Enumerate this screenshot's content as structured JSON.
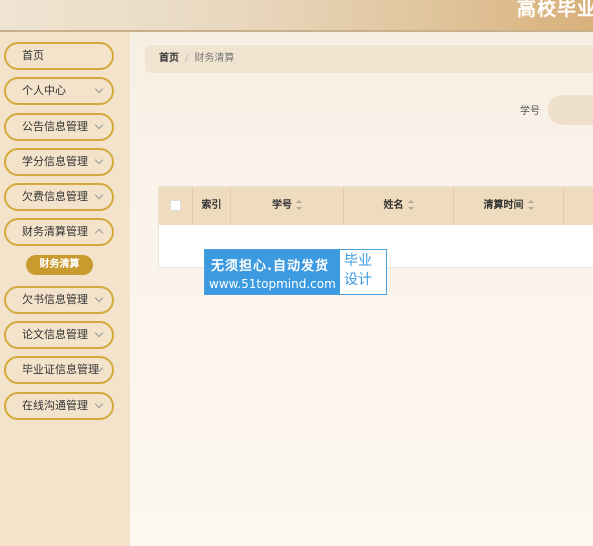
{
  "header": {
    "title": "高校毕业"
  },
  "sidebar": {
    "items": [
      {
        "label": "首页",
        "arrow": false
      },
      {
        "label": "个人中心",
        "arrow": true
      },
      {
        "label": "公告信息管理",
        "arrow": true
      },
      {
        "label": "学分信息管理",
        "arrow": true
      },
      {
        "label": "欠费信息管理",
        "arrow": true
      },
      {
        "label": "财务清算管理",
        "arrow": true
      },
      {
        "label": "欠书信息管理",
        "arrow": true
      },
      {
        "label": "论文信息管理",
        "arrow": true
      },
      {
        "label": "毕业证信息管理",
        "arrow": true
      },
      {
        "label": "在线沟通管理",
        "arrow": true
      }
    ],
    "active_sub": "财务清算"
  },
  "breadcrumb": {
    "home": "首页",
    "separator": "/",
    "current": "财务清算"
  },
  "search": {
    "label": "学号",
    "placeholder": ""
  },
  "table": {
    "columns": [
      "索引",
      "学号",
      "姓名",
      "清算时间"
    ],
    "rows": []
  },
  "watermark": {
    "line1": "无须担心.自动发货",
    "line2": "www.51topmind.com",
    "right_line1": "毕业",
    "right_line2": "设计"
  },
  "colors": {
    "accent": "#d4aa3c",
    "active": "#c99a2e",
    "watermark": "#3b9ae0"
  }
}
